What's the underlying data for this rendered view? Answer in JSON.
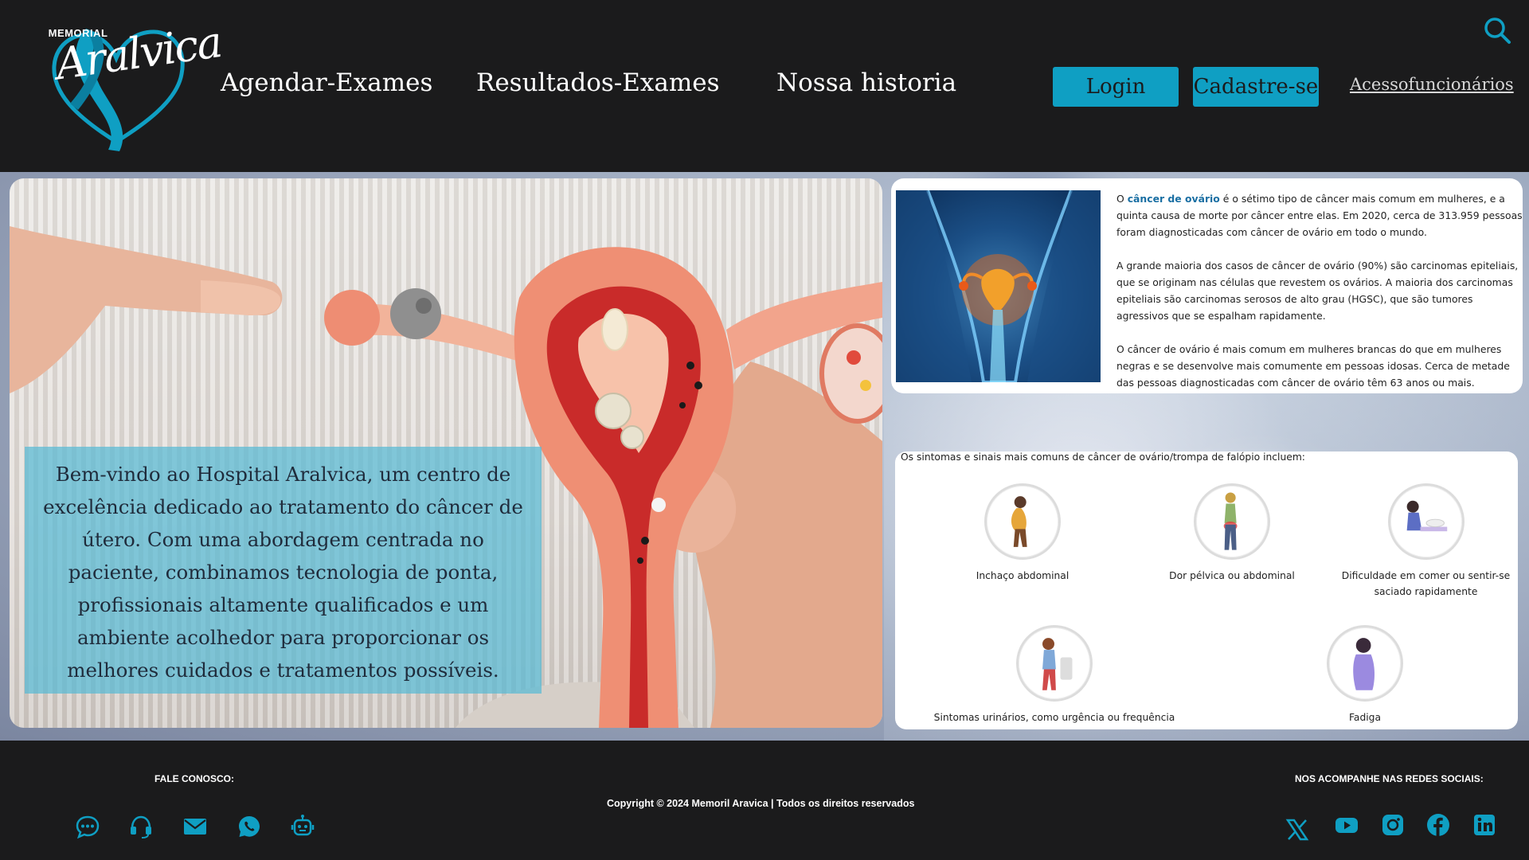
{
  "header": {
    "logo_small": "MEMORIAL",
    "logo_big": "Aralvica",
    "nav": [
      "Agendar-Exames",
      "Resultados-Exames",
      "Nossa historia"
    ],
    "login_label": "Login",
    "signup_label": "Cadastre-se",
    "staff_access_label": "Acessofuncionários",
    "search_icon": "search-icon"
  },
  "hero": {
    "welcome": "Bem-vindo ao Hospital Aralvica, um centro de excelência dedicado ao tratamento do câncer de útero. Com uma abordagem centrada no paciente, combinamos tecnologia de ponta, profissionais altamente qualificados e um ambiente acolhedor para proporcionar os melhores cuidados e tratamentos possíveis."
  },
  "info": {
    "p1_prefix": "O ",
    "p1_highlight": "câncer de ovário",
    "p1_rest": " é o sétimo tipo de câncer mais comum em mulheres, e a quinta causa de morte por câncer entre elas. Em 2020, cerca de 313.959 pessoas foram diagnosticadas com câncer de ovário em todo o mundo.",
    "p2": "A grande maioria dos casos de câncer de ovário (90%) são carcinomas epiteliais, que se originam nas células que revestem os ovários. A maioria dos carcinomas epiteliais são carcinomas serosos de alto grau (HGSC), que são tumores agressivos que se espalham rapidamente.",
    "p3": "O câncer de ovário é mais comum em mulheres brancas do que em mulheres negras e se desenvolve mais comumente em pessoas idosas. Cerca de metade das pessoas diagnosticadas com câncer de ovário têm 63 anos ou mais."
  },
  "symptoms": {
    "title": "Os sintomas e sinais mais comuns de câncer de ovário/trompa de falópio incluem:",
    "items": [
      "Inchaço abdominal",
      "Dor pélvica ou abdominal",
      "Dificuldade em comer ou sentir-se saciado rapidamente",
      "Sintomas urinários, como urgência ou frequência",
      "Fadiga"
    ]
  },
  "footer": {
    "contact_label": "FALE CONOSCO:",
    "copyright": "Copyright © 2024 Memoril Aravica | Todos os direitos reservados",
    "social_label": "NOS ACOMPANHE NAS REDES SOCIAIS:",
    "contact_icons": [
      "chat-icon",
      "headset-icon",
      "mail-icon",
      "whatsapp-icon",
      "robot-icon"
    ],
    "social_icons": [
      "x-twitter-icon",
      "youtube-icon",
      "instagram-icon",
      "facebook-icon",
      "linkedin-icon"
    ]
  },
  "colors": {
    "background": "#1b1b1c",
    "accent": "#0f9fc3",
    "welcome_box": "#58bad4"
  }
}
